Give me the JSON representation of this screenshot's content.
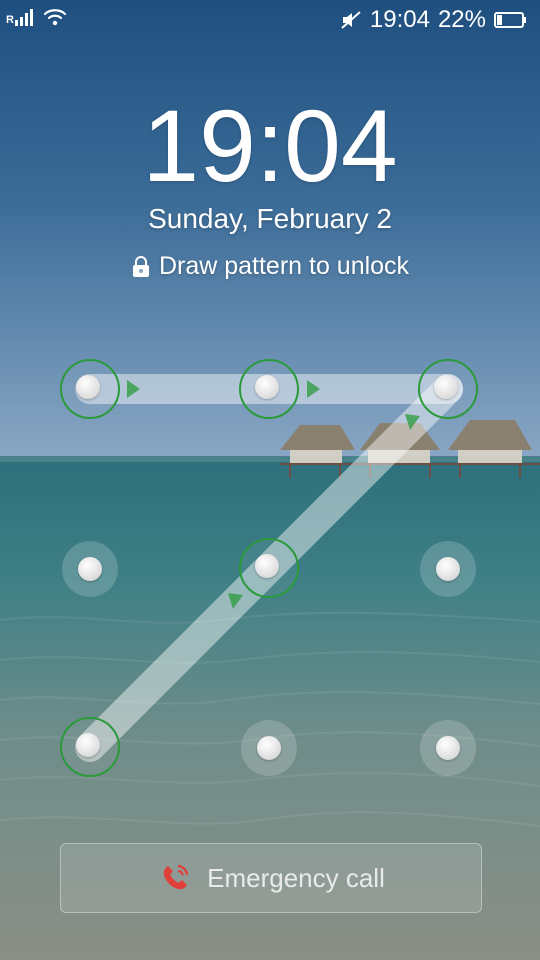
{
  "status_bar": {
    "network_label": "R",
    "time": "19:04",
    "battery_percent": "22%",
    "battery_level": 0.22,
    "icons": [
      "signal-icon",
      "wifi-icon",
      "mute-icon",
      "battery-icon"
    ]
  },
  "lock": {
    "time": "19:04",
    "date": "Sunday, February 2",
    "hint": "Draw pattern to unlock"
  },
  "pattern": {
    "grid": 3,
    "sequence": [
      "1",
      "2",
      "3",
      "5",
      "7"
    ]
  },
  "emergency": {
    "label": "Emergency call"
  },
  "colors": {
    "accent_green": "#2a9a3a",
    "call_red": "#e0403a"
  }
}
